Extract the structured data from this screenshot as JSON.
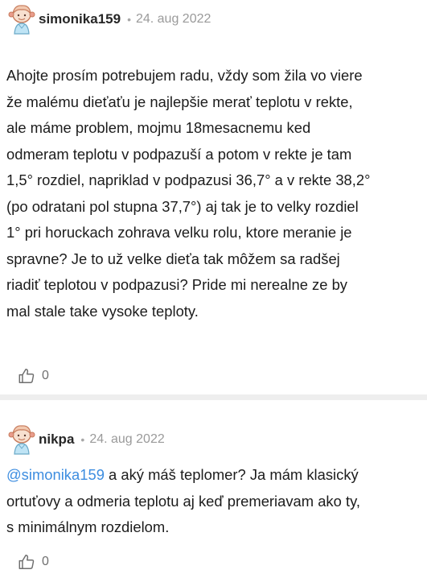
{
  "posts": [
    {
      "username": "simonika159",
      "separator": "•",
      "date": "24. aug 2022",
      "text": "Ahojte prosím potrebujem radu, vždy som žila vo viere\nže malému dieťaťu je najlepšie merať teplotu v rekte,\nale máme problem, mojmu 18mesacnemu ked\nodmeram teplotu v podpazuší a potom v rekte je tam\n1,5° rozdiel, napriklad v podpazusi 36,7° a v rekte 38,2°\n(po odratani pol stupna 37,7°) aj tak je to velky rozdiel\n1° pri horuckach zohrava velku rolu, ktore meranie je\nspravne? Je to už velke dieťa tak môžem sa radšej\nriadiť teplotou v podpazusi? Pride mi nerealne ze by\nmal stale take vysoke teploty.",
      "likes": "0",
      "like_icon": "thumbs-up-icon"
    },
    {
      "username": "nikpa",
      "separator": "•",
      "date": "24. aug 2022",
      "mention": "@simonika159",
      "text": " a aký máš teplomer? Ja mám klasický\nortuťovy a odmeria teplotu aj keď premeriavam ako ty,\ns minimálnym rozdielom.",
      "likes": "0",
      "like_icon": "thumbs-up-icon"
    }
  ],
  "colors": {
    "mention": "#3d8de0",
    "divider": "#eeeeee",
    "date": "#9a9a9a"
  }
}
